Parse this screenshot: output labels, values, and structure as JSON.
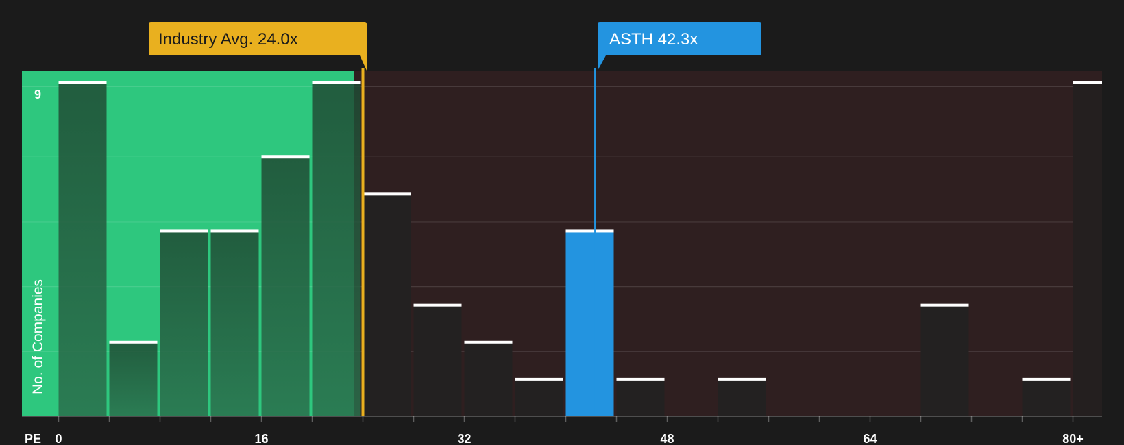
{
  "chart_data": {
    "type": "bar",
    "title": "",
    "xlabel": "PE",
    "ylabel": "No. of Companies",
    "x_ticks": [
      "0",
      "16",
      "32",
      "48",
      "64",
      "80+"
    ],
    "y_ticks_labeled": [
      "9"
    ],
    "ylim": [
      0,
      9
    ],
    "xlim": [
      -3,
      82
    ],
    "bin_width": 4,
    "bins": [
      {
        "start": 0,
        "count": 9
      },
      {
        "start": 4,
        "count": 2
      },
      {
        "start": 8,
        "count": 5
      },
      {
        "start": 12,
        "count": 5
      },
      {
        "start": 16,
        "count": 7
      },
      {
        "start": 20,
        "count": 9
      },
      {
        "start": 24,
        "count": 6
      },
      {
        "start": 28,
        "count": 3
      },
      {
        "start": 32,
        "count": 2
      },
      {
        "start": 36,
        "count": 1
      },
      {
        "start": 40,
        "count": 5
      },
      {
        "start": 44,
        "count": 1
      },
      {
        "start": 48,
        "count": 0
      },
      {
        "start": 52,
        "count": 1
      },
      {
        "start": 56,
        "count": 0
      },
      {
        "start": 60,
        "count": 0
      },
      {
        "start": 64,
        "count": 0
      },
      {
        "start": 68,
        "count": 3
      },
      {
        "start": 72,
        "count": 0
      },
      {
        "start": 76,
        "count": 1
      },
      {
        "start": 80,
        "count": 9
      }
    ],
    "highlight_bin_start": 40,
    "undervalued_region_end": 23,
    "markers": [
      {
        "id": "industry",
        "label": "Industry Avg. 24.0x",
        "value": 24.0,
        "color": "#e9b01f",
        "text_color": "#1b1b1b"
      },
      {
        "id": "company",
        "label": "ASTH 42.3x",
        "value": 42.3,
        "color": "#2394e0",
        "text_color": "#ffffff"
      }
    ]
  },
  "colors": {
    "background": "#1b1b1b",
    "undervalued_region": "#2ec77e",
    "overvalued_region": "#2f1f20",
    "bar_in_green": "#1f4d35",
    "bar_dark": "#232121",
    "highlight_bar": "#2394e0",
    "bar_cap": "#ffffff",
    "axis_text": "#ffffff"
  }
}
